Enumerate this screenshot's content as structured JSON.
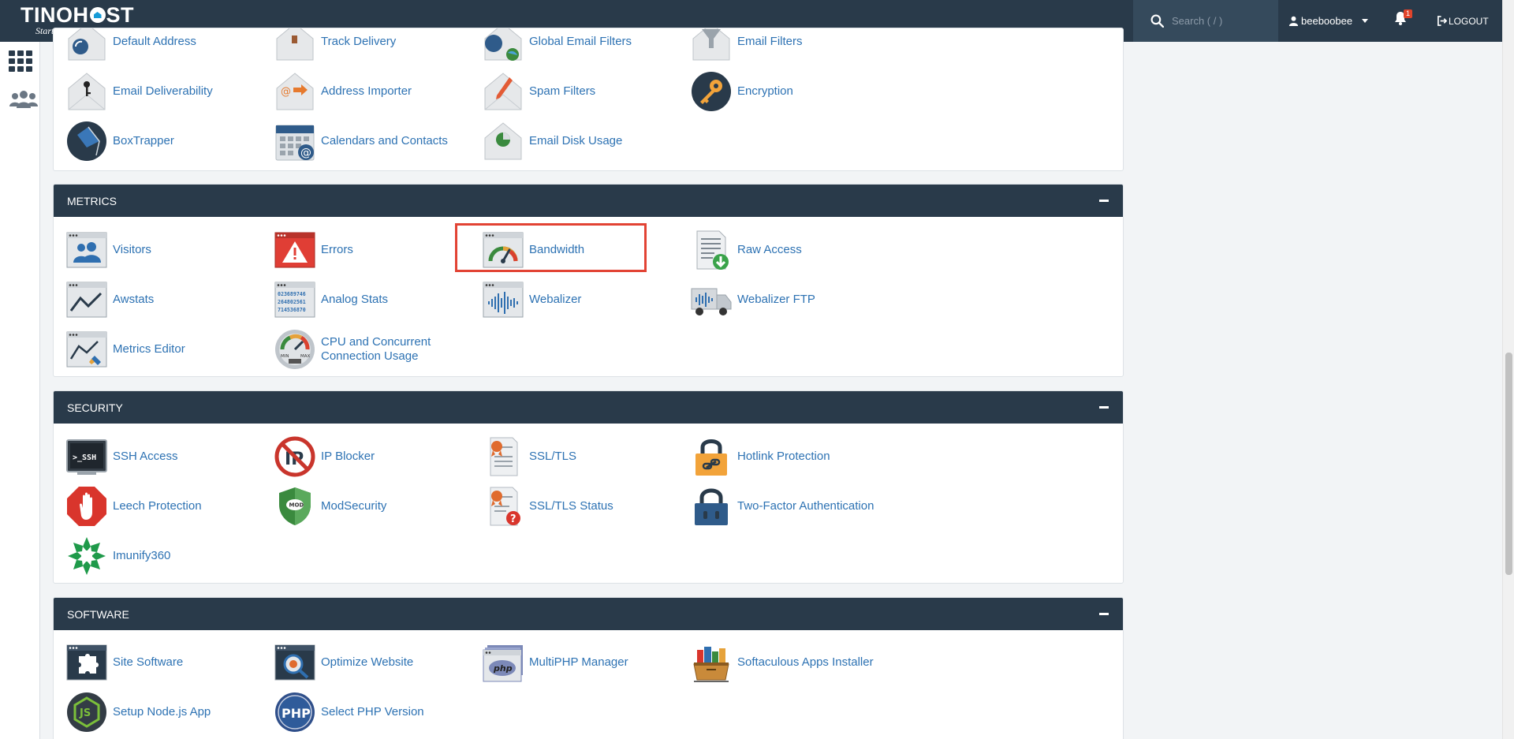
{
  "brand": {
    "name_left": "TINO",
    "name_right": "ST",
    "tagline": "Start Your Business"
  },
  "header": {
    "search_placeholder": "Search ( / )",
    "username": "beeboobee",
    "notification_count": "1",
    "logout_label": "LOGOUT"
  },
  "email": {
    "items": [
      {
        "label": "Default Address",
        "icon": "default-address-icon"
      },
      {
        "label": "Track Delivery",
        "icon": "track-delivery-icon"
      },
      {
        "label": "Global Email Filters",
        "icon": "global-email-filters-icon"
      },
      {
        "label": "Email Filters",
        "icon": "email-filters-icon"
      },
      {
        "label": "Email Deliverability",
        "icon": "email-deliverability-icon"
      },
      {
        "label": "Address Importer",
        "icon": "address-importer-icon"
      },
      {
        "label": "Spam Filters",
        "icon": "spam-filters-icon"
      },
      {
        "label": "Encryption",
        "icon": "encryption-icon"
      },
      {
        "label": "BoxTrapper",
        "icon": "boxtrapper-icon"
      },
      {
        "label": "Calendars and Contacts",
        "icon": "calendars-contacts-icon"
      },
      {
        "label": "Email Disk Usage",
        "icon": "email-disk-usage-icon"
      }
    ]
  },
  "metrics": {
    "title": "METRICS",
    "items": [
      {
        "label": "Visitors",
        "icon": "visitors-icon"
      },
      {
        "label": "Errors",
        "icon": "errors-icon"
      },
      {
        "label": "Bandwidth",
        "icon": "bandwidth-icon"
      },
      {
        "label": "Raw Access",
        "icon": "raw-access-icon"
      },
      {
        "label": "Awstats",
        "icon": "awstats-icon"
      },
      {
        "label": "Analog Stats",
        "icon": "analog-stats-icon"
      },
      {
        "label": "Webalizer",
        "icon": "webalizer-icon"
      },
      {
        "label": "Webalizer FTP",
        "icon": "webalizer-ftp-icon"
      },
      {
        "label": "Metrics Editor",
        "icon": "metrics-editor-icon"
      },
      {
        "label_line1": "CPU and Concurrent",
        "label_line2": "Connection Usage",
        "icon": "cpu-usage-icon"
      }
    ]
  },
  "security": {
    "title": "SECURITY",
    "items": [
      {
        "label": "SSH Access",
        "icon": "ssh-access-icon"
      },
      {
        "label": "IP Blocker",
        "icon": "ip-blocker-icon"
      },
      {
        "label": "SSL/TLS",
        "icon": "ssl-tls-icon"
      },
      {
        "label": "Hotlink Protection",
        "icon": "hotlink-protection-icon"
      },
      {
        "label": "Leech Protection",
        "icon": "leech-protection-icon"
      },
      {
        "label": "ModSecurity",
        "icon": "modsecurity-icon"
      },
      {
        "label": "SSL/TLS Status",
        "icon": "ssl-tls-status-icon"
      },
      {
        "label": "Two-Factor Authentication",
        "icon": "two-factor-icon"
      },
      {
        "label": "Imunify360",
        "icon": "imunify360-icon"
      }
    ]
  },
  "software": {
    "title": "SOFTWARE",
    "items": [
      {
        "label": "Site Software",
        "icon": "site-software-icon"
      },
      {
        "label": "Optimize Website",
        "icon": "optimize-website-icon"
      },
      {
        "label": "MultiPHP Manager",
        "icon": "multiphp-manager-icon"
      },
      {
        "label": "Softaculous Apps Installer",
        "icon": "softaculous-icon"
      },
      {
        "label": "Setup Node.js App",
        "icon": "nodejs-icon"
      },
      {
        "label": "Select PHP Version",
        "icon": "select-php-icon"
      }
    ]
  },
  "icon_texts": {
    "ssh": ">_SSH",
    "ip": "IP",
    "mod": "MOD",
    "php": "php",
    "php_caps": "PHP",
    "js": "JS",
    "cpu_min": "MIN",
    "cpu_max": "MAX",
    "analog_line1": "023689746",
    "analog_line2": "264802561",
    "analog_line3": "714536870",
    "ssl_status_mark": "?"
  },
  "colors": {
    "header_bg": "#293a4a",
    "link": "#2d72b3",
    "highlight": "#e24334",
    "badge": "#e1442b"
  }
}
